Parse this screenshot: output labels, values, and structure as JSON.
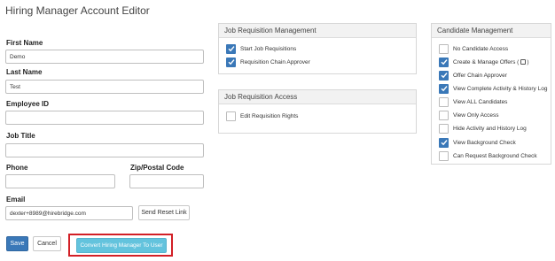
{
  "page": {
    "title": "Hiring Manager Account Editor"
  },
  "form": {
    "first_name": {
      "label": "First Name",
      "value": "Demo"
    },
    "last_name": {
      "label": "Last Name",
      "value": "Test"
    },
    "employee_id": {
      "label": "Employee ID",
      "value": ""
    },
    "job_title": {
      "label": "Job Title",
      "value": ""
    },
    "phone": {
      "label": "Phone",
      "value": ""
    },
    "zip": {
      "label": "Zip/Postal Code",
      "value": ""
    },
    "email": {
      "label": "Email",
      "value": "dexter+8989@hirebridge.com"
    },
    "send_reset_label": "Send Reset Link"
  },
  "actions": {
    "save_label": "Save",
    "cancel_label": "Cancel",
    "convert_label": "Convert Hiring Manager To User",
    "highlight_color": "#d21f26"
  },
  "job_requisition_management": {
    "title": "Job Requisition Management",
    "items": [
      {
        "label": "Start Job Requisitions",
        "checked": true
      },
      {
        "label": "Requisition Chain Approver",
        "checked": true
      }
    ]
  },
  "job_requisition_access": {
    "title": "Job Requisition Access",
    "items": [
      {
        "label": "Edit Requisition Rights",
        "checked": false
      }
    ]
  },
  "candidate_management": {
    "title": "Candidate Management",
    "items": [
      {
        "label": "No Candidate Access",
        "checked": false
      },
      {
        "label": "Create & Manage Offers (",
        "suffix": ")",
        "icon": "lock-icon",
        "checked": true
      },
      {
        "label": "Offer Chain Approver",
        "checked": true
      },
      {
        "label": "View Complete Activity & History Log",
        "checked": true
      },
      {
        "label": "View ALL Candidates",
        "checked": false
      },
      {
        "label": "View Only Access",
        "checked": false
      },
      {
        "label": "Hide Activity and History Log",
        "checked": false
      },
      {
        "label": "View Background Check",
        "checked": true
      },
      {
        "label": "Can Request Background Check",
        "checked": false
      }
    ]
  },
  "colors": {
    "checkbox_checked": "#3a78b8",
    "primary_button": "#3a78b8",
    "convert_button": "#63c3dd"
  }
}
